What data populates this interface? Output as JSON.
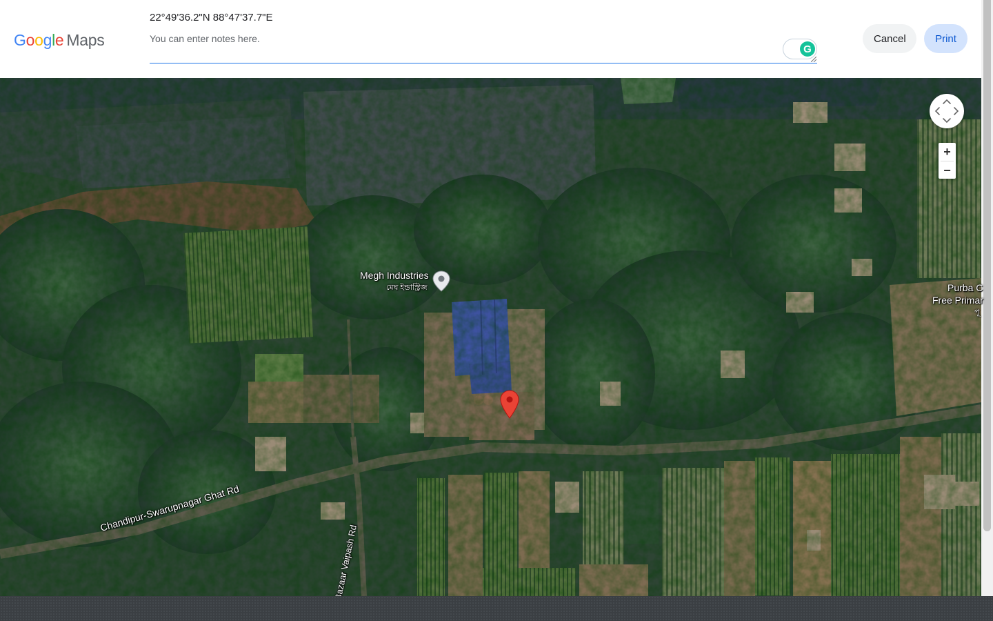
{
  "header": {
    "logo_google": "Google",
    "logo_maps": "Maps",
    "coordinates": "22°49'36.2\"N 88°47'37.7\"E",
    "notes_placeholder": "You can enter notes here.",
    "notes_value": "",
    "cancel_label": "Cancel",
    "print_label": "Print"
  },
  "map": {
    "type": "satellite",
    "pois": [
      {
        "name": "Megh Industries",
        "local_name": "মেঘ ইন্ডাস্ট্রিজ",
        "icon": "place-pin-icon"
      }
    ],
    "places": [
      {
        "name": "Purba C",
        "line2": "Free Primar",
        "line3": "পূ"
      }
    ],
    "roads": [
      {
        "name": "Chandipur-Swarupnagar Ghat Rd"
      },
      {
        "name": "Bazaar Vaipash Rd"
      }
    ],
    "marker": {
      "icon": "red-marker-icon",
      "color": "#ea4335"
    },
    "controls": {
      "zoom_in": "+",
      "zoom_out": "−"
    }
  },
  "colors": {
    "accent": "#1a73e8",
    "print_bg": "#d3e3fd",
    "print_text": "#0b57d0",
    "cancel_bg": "#f1f3f4",
    "grammarly": "#15c39a"
  }
}
